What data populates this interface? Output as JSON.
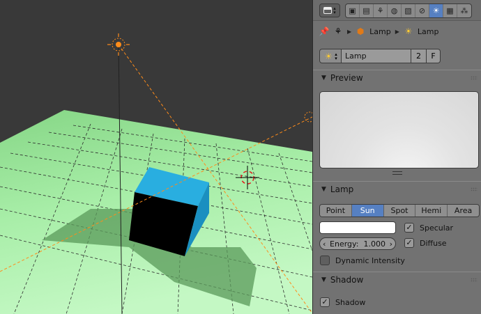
{
  "properties": {
    "context_tabs": [
      "render-icon",
      "render-layers-icon",
      "scene-icon",
      "world-icon",
      "object-icon",
      "constraints-icon",
      "object-data-lamp-icon",
      "texture-icon",
      "particles-icon"
    ],
    "active_tab": "object-data-lamp-icon",
    "breadcrumb": {
      "object_name": "Lamp",
      "data_name": "Lamp"
    },
    "datablock": {
      "name": "Lamp",
      "users": "2",
      "fake_user": "F"
    },
    "panels": {
      "preview": {
        "title": "Preview"
      },
      "lamp": {
        "title": "Lamp",
        "types": [
          "Point",
          "Sun",
          "Spot",
          "Hemi",
          "Area"
        ],
        "active_type": "Sun",
        "color": "#ffffff",
        "energy_label": "Energy:",
        "energy_value": "1.000",
        "specular_label": "Specular",
        "specular": true,
        "diffuse_label": "Diffuse",
        "diffuse": true,
        "dynamic_label": "Dynamic Intensity",
        "dynamic": false
      },
      "shadow": {
        "title": "Shadow",
        "shadow_label": "Shadow",
        "shadow": true
      }
    }
  },
  "colors": {
    "accent_blue": "#5680c2",
    "floor_green": "#9be69b",
    "cube_top": "#29aee0",
    "selection_orange": "#ff8c1a"
  }
}
